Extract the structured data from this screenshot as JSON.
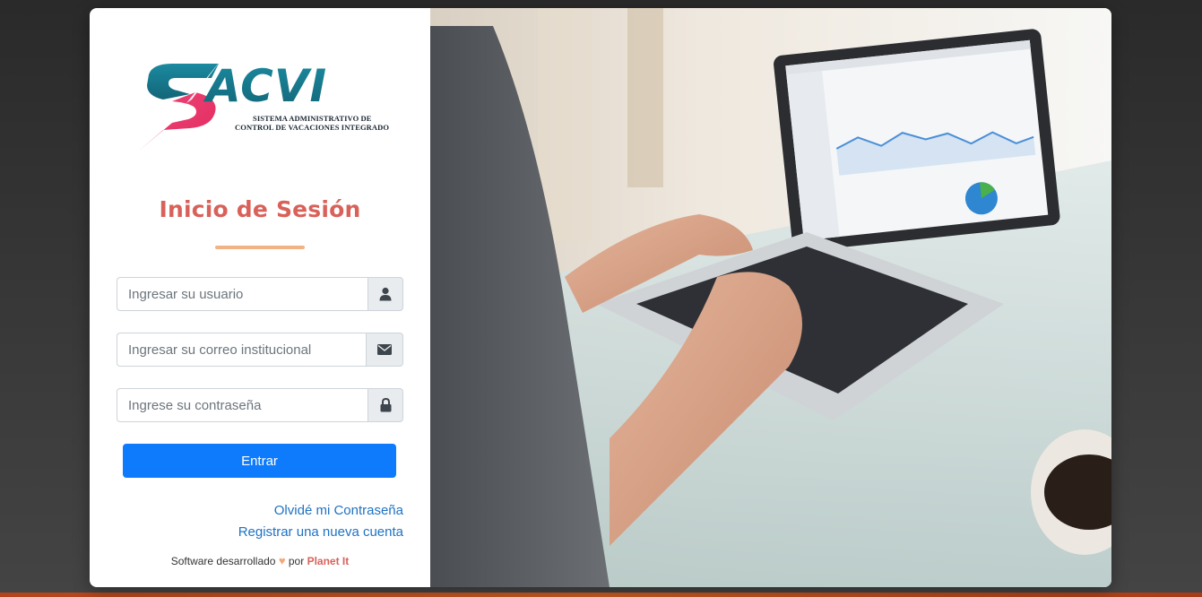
{
  "logo": {
    "text": "SACVI",
    "subtitle_line1": "SISTEMA ADMINISTRATIVO DE",
    "subtitle_line2": "CONTROL DE VACACIONES INTEGRADO",
    "colors": {
      "teal": "#1a7a8c",
      "pink": "#e8356b"
    }
  },
  "login": {
    "title": "Inicio de Sesión",
    "username_placeholder": "Ingresar su usuario",
    "email_placeholder": "Ingresar su correo institucional",
    "password_placeholder": "Ingrese su contraseña",
    "username_icon": "user-icon",
    "email_icon": "envelope-icon",
    "password_icon": "lock-icon",
    "submit_label": "Entrar",
    "forgot_link": "Olvidé mi Contraseña",
    "register_link": "Registrar una nueva cuenta"
  },
  "footer": {
    "prefix": "Software desarrollado",
    "heart": "♥",
    "middle": "por",
    "brand": "Planet It"
  },
  "colors": {
    "title": "#d8625a",
    "accent_bar": "#f1b384",
    "button": "#0d7bfc",
    "link": "#1f72c4"
  }
}
